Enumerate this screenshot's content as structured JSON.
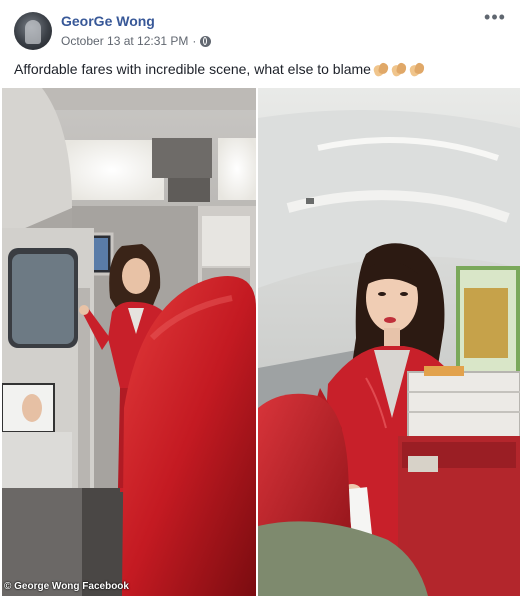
{
  "post": {
    "author": "GeorGe Wong",
    "date": "October 13 at 12:31 PM",
    "separator": "·",
    "privacy_icon": "globe-icon",
    "more_icon": "more-options-icon",
    "caption": "Affordable fares with incredible scene, what else to blame",
    "caption_emojis": [
      "clap-icon",
      "clap-icon",
      "clap-icon"
    ]
  },
  "photo_credit": "© George Wong Facebook",
  "colors": {
    "author_link": "#385898",
    "meta_text": "#616770",
    "uniform_red": "#c8202a"
  }
}
